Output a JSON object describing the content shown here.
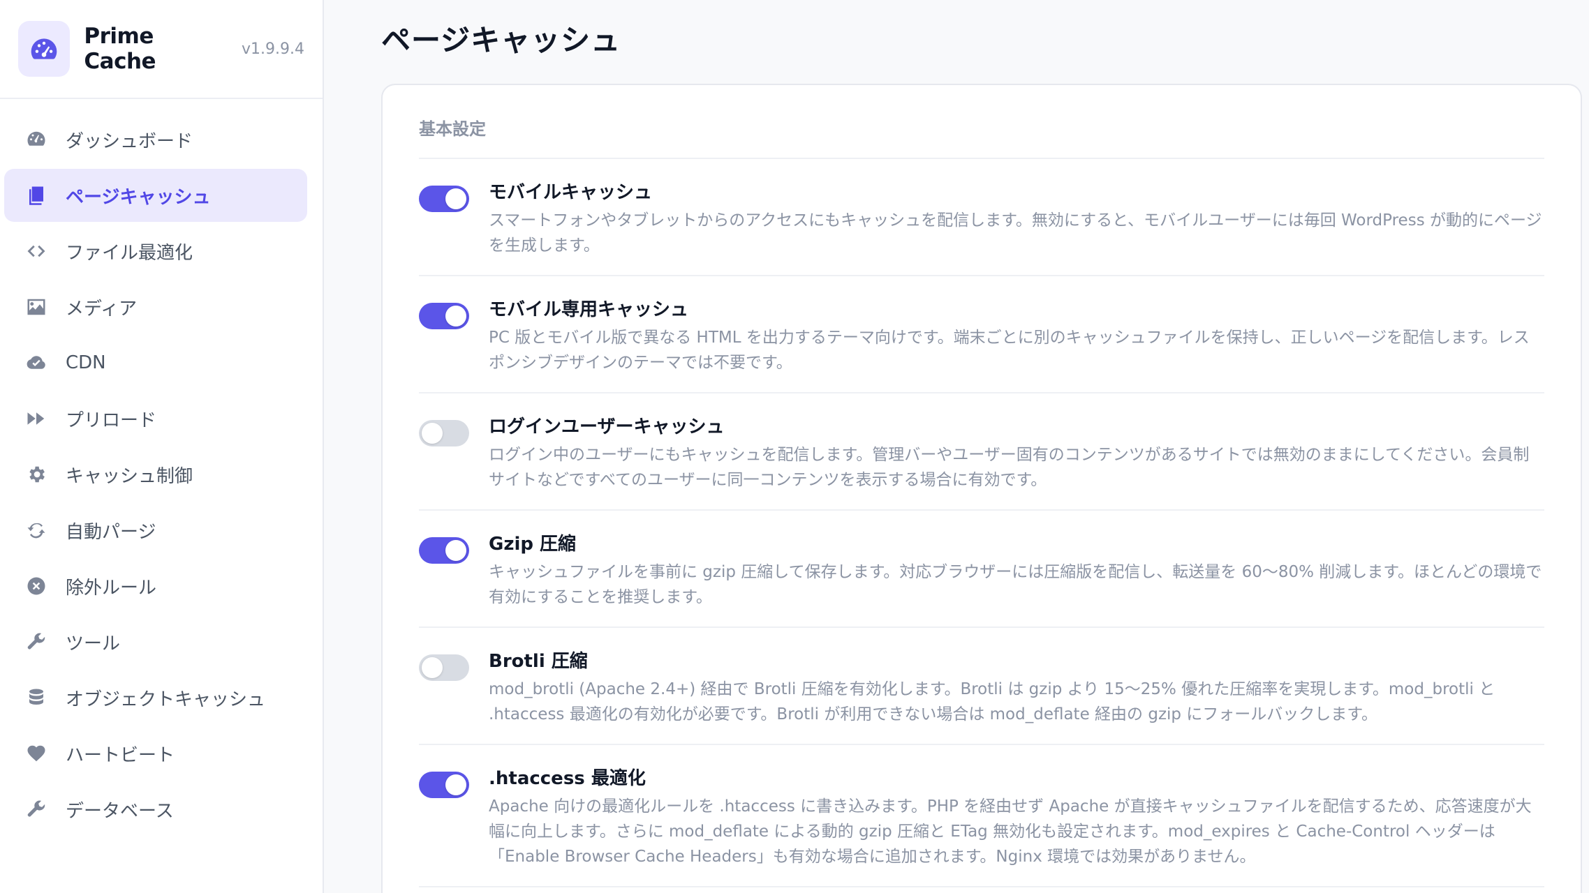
{
  "brand": {
    "name": "Prime Cache",
    "version": "v1.9.9.4"
  },
  "sidebar": {
    "items": [
      {
        "label": "ダッシュボード",
        "icon": "dashboard-icon",
        "active": false
      },
      {
        "label": "ページキャッシュ",
        "icon": "page-cache-icon",
        "active": true
      },
      {
        "label": "ファイル最適化",
        "icon": "code-icon",
        "active": false
      },
      {
        "label": "メディア",
        "icon": "image-icon",
        "active": false
      },
      {
        "label": "CDN",
        "icon": "cloud-icon",
        "active": false
      },
      {
        "label": "プリロード",
        "icon": "fast-forward-icon",
        "active": false
      },
      {
        "label": "キャッシュ制御",
        "icon": "gear-icon",
        "active": false
      },
      {
        "label": "自動パージ",
        "icon": "sync-icon",
        "active": false
      },
      {
        "label": "除外ルール",
        "icon": "close-circle-icon",
        "active": false
      },
      {
        "label": "ツール",
        "icon": "wrench-icon",
        "active": false
      },
      {
        "label": "オブジェクトキャッシュ",
        "icon": "database-icon",
        "active": false
      },
      {
        "label": "ハートビート",
        "icon": "heart-icon",
        "active": false
      },
      {
        "label": "データベース",
        "icon": "wrench-icon",
        "active": false
      }
    ]
  },
  "main": {
    "title": "ページキャッシュ",
    "section_title": "基本設定",
    "settings": [
      {
        "title": "モバイルキャッシュ",
        "enabled": true,
        "desc": "スマートフォンやタブレットからのアクセスにもキャッシュを配信します。無効にすると、モバイルユーザーには毎回 WordPress が動的にページを生成します。"
      },
      {
        "title": "モバイル専用キャッシュ",
        "enabled": true,
        "desc": "PC 版とモバイル版で異なる HTML を出力するテーマ向けです。端末ごとに別のキャッシュファイルを保持し、正しいページを配信します。レスポンシブデザインのテーマでは不要です。"
      },
      {
        "title": "ログインユーザーキャッシュ",
        "enabled": false,
        "desc": "ログイン中のユーザーにもキャッシュを配信します。管理バーやユーザー固有のコンテンツがあるサイトでは無効のままにしてください。会員制サイトなどですべてのユーザーに同一コンテンツを表示する場合に有効です。"
      },
      {
        "title": "Gzip 圧縮",
        "enabled": true,
        "desc": "キャッシュファイルを事前に gzip 圧縮して保存します。対応ブラウザーには圧縮版を配信し、転送量を 60〜80% 削減します。ほとんどの環境で有効にすることを推奨します。"
      },
      {
        "title": "Brotli 圧縮",
        "enabled": false,
        "desc": "mod_brotli (Apache 2.4+) 経由で Brotli 圧縮を有効化します。Brotli は gzip より 15〜25% 優れた圧縮率を実現します。mod_brotli と .htaccess 最適化の有効化が必要です。Brotli が利用できない場合は mod_deflate 経由の gzip にフォールバックします。"
      },
      {
        "title": ".htaccess 最適化",
        "enabled": true,
        "desc": "Apache 向けの最適化ルールを .htaccess に書き込みます。PHP を経由せず Apache が直接キャッシュファイルを配信するため、応答速度が大幅に向上します。さらに mod_deflate による動的 gzip 圧縮と ETag 無効化も設定されます。mod_expires と Cache-Control ヘッダーは「Enable Browser Cache Headers」も有効な場合に追加されます。Nginx 環境では効果がありません。"
      }
    ]
  },
  "colors": {
    "accent": "#5b55e8",
    "active_bg": "#ebe9fd",
    "toggle_off": "#d8dce3"
  }
}
